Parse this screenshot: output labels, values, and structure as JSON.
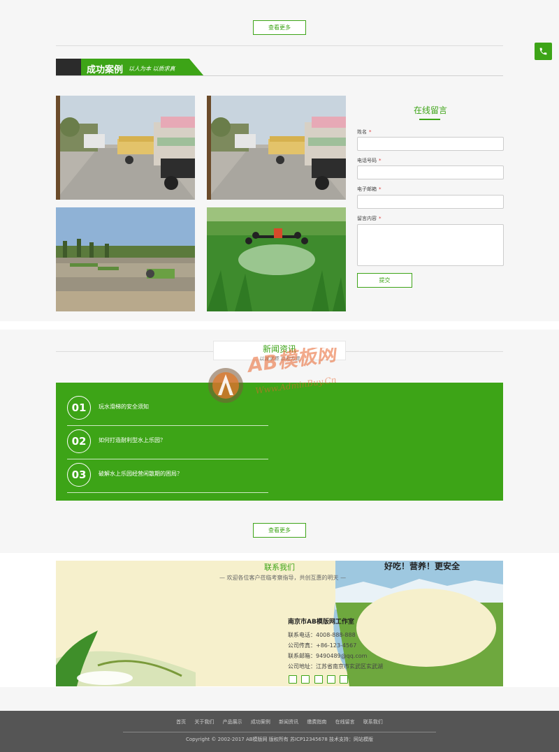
{
  "top": {
    "more_label": "查看更多"
  },
  "cases": {
    "title": "成功案例",
    "slogan": "以人为本  以质求真",
    "photos": [
      {
        "label": "trucks-loaded-grain-bags-1"
      },
      {
        "label": "trucks-loaded-grain-bags-2"
      },
      {
        "label": "rice-paddy-transplanting"
      },
      {
        "label": "drone-spraying-wheat-field"
      }
    ]
  },
  "message_form": {
    "title": "在线留言",
    "fields": [
      {
        "label": "姓名",
        "required": "*"
      },
      {
        "label": "电话号码",
        "required": "*"
      },
      {
        "label": "电子邮箱",
        "required": "*"
      },
      {
        "label": "留言内容",
        "required": "*"
      }
    ],
    "submit_label": "提交"
  },
  "news": {
    "title": "新闻资讯",
    "subtitle": "以诚求质  以和为贵",
    "items": [
      {
        "num": "01",
        "title": "玩水滑梯的安全须知"
      },
      {
        "num": "02",
        "title": "如何打造耐利型水上乐园？"
      },
      {
        "num": "03",
        "title": "破解水上乐园经营闲散期的困局？"
      }
    ],
    "more_label": "查看更多"
  },
  "watermark": {
    "brand": "AB模板网",
    "url": "Www.AdminBuy.Cn"
  },
  "contact": {
    "title": "联系我们",
    "subtitle": "— 欢迎各位客户莅临考察指导，共创互惠的明天 —",
    "banner_text": "好吃！营养！更安全",
    "company": "南京市AB模版网工作室",
    "phone": "联系电话：4008-888-888",
    "fax": "公司传真：+86-123-4567",
    "email": "联系邮箱：9490489@qq.com",
    "address": "公司地址：江苏省南京市玄武区玄武湖"
  },
  "footer": {
    "nav": [
      "首页",
      "关于我们",
      "产品展示",
      "成功案例",
      "新闻资讯",
      "缴费指南",
      "在线留言",
      "联系我们"
    ],
    "copyright": "Copyright © 2002-2017 AB模版网 版权所有 苏ICP12345678    技术支持：网站模版"
  },
  "colors": {
    "accent": "#3da417",
    "footer_bg": "#555555",
    "dark_tab": "#2b2b2b"
  }
}
